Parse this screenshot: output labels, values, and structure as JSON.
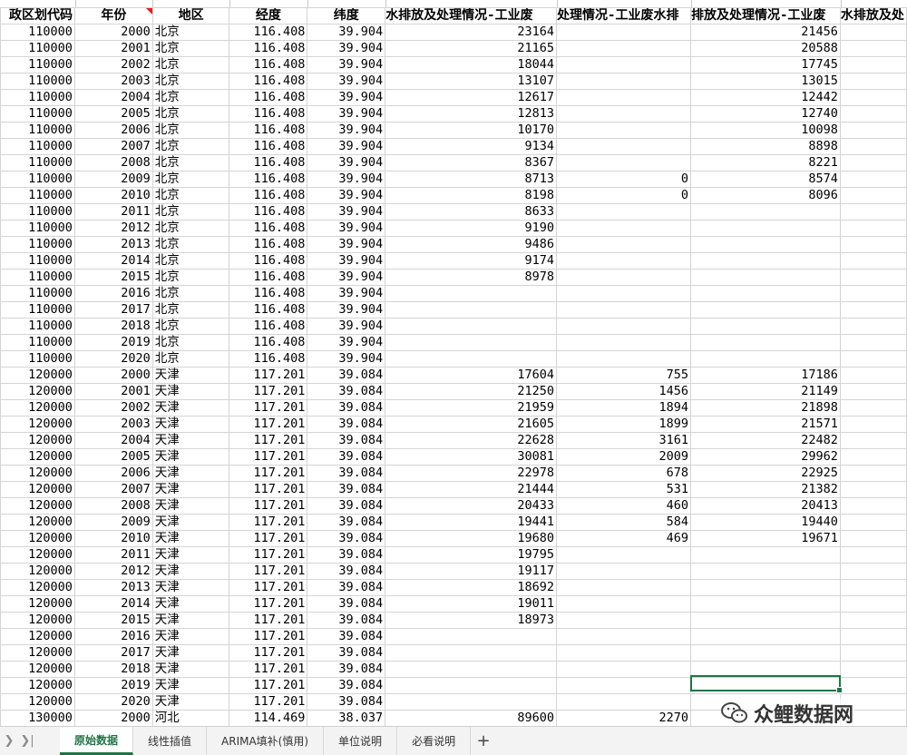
{
  "headers": [
    "政区划代码",
    "年份",
    "地区",
    "经度",
    "纬度",
    "水排放及处理情况-工业废",
    "处理情况-工业废水排",
    "排放及处理情况-工业废",
    "水排放及处"
  ],
  "rows": [
    [
      "110000",
      "2000",
      "北京",
      "116.408",
      "39.904",
      "23164",
      "",
      "21456"
    ],
    [
      "110000",
      "2001",
      "北京",
      "116.408",
      "39.904",
      "21165",
      "",
      "20588"
    ],
    [
      "110000",
      "2002",
      "北京",
      "116.408",
      "39.904",
      "18044",
      "",
      "17745"
    ],
    [
      "110000",
      "2003",
      "北京",
      "116.408",
      "39.904",
      "13107",
      "",
      "13015"
    ],
    [
      "110000",
      "2004",
      "北京",
      "116.408",
      "39.904",
      "12617",
      "",
      "12442"
    ],
    [
      "110000",
      "2005",
      "北京",
      "116.408",
      "39.904",
      "12813",
      "",
      "12740"
    ],
    [
      "110000",
      "2006",
      "北京",
      "116.408",
      "39.904",
      "10170",
      "",
      "10098"
    ],
    [
      "110000",
      "2007",
      "北京",
      "116.408",
      "39.904",
      "9134",
      "",
      "8898"
    ],
    [
      "110000",
      "2008",
      "北京",
      "116.408",
      "39.904",
      "8367",
      "",
      "8221"
    ],
    [
      "110000",
      "2009",
      "北京",
      "116.408",
      "39.904",
      "8713",
      "0",
      "8574"
    ],
    [
      "110000",
      "2010",
      "北京",
      "116.408",
      "39.904",
      "8198",
      "0",
      "8096"
    ],
    [
      "110000",
      "2011",
      "北京",
      "116.408",
      "39.904",
      "8633",
      "",
      ""
    ],
    [
      "110000",
      "2012",
      "北京",
      "116.408",
      "39.904",
      "9190",
      "",
      ""
    ],
    [
      "110000",
      "2013",
      "北京",
      "116.408",
      "39.904",
      "9486",
      "",
      ""
    ],
    [
      "110000",
      "2014",
      "北京",
      "116.408",
      "39.904",
      "9174",
      "",
      ""
    ],
    [
      "110000",
      "2015",
      "北京",
      "116.408",
      "39.904",
      "8978",
      "",
      ""
    ],
    [
      "110000",
      "2016",
      "北京",
      "116.408",
      "39.904",
      "",
      "",
      ""
    ],
    [
      "110000",
      "2017",
      "北京",
      "116.408",
      "39.904",
      "",
      "",
      ""
    ],
    [
      "110000",
      "2018",
      "北京",
      "116.408",
      "39.904",
      "",
      "",
      ""
    ],
    [
      "110000",
      "2019",
      "北京",
      "116.408",
      "39.904",
      "",
      "",
      ""
    ],
    [
      "110000",
      "2020",
      "北京",
      "116.408",
      "39.904",
      "",
      "",
      ""
    ],
    [
      "120000",
      "2000",
      "天津",
      "117.201",
      "39.084",
      "17604",
      "755",
      "17186"
    ],
    [
      "120000",
      "2001",
      "天津",
      "117.201",
      "39.084",
      "21250",
      "1456",
      "21149"
    ],
    [
      "120000",
      "2002",
      "天津",
      "117.201",
      "39.084",
      "21959",
      "1894",
      "21898"
    ],
    [
      "120000",
      "2003",
      "天津",
      "117.201",
      "39.084",
      "21605",
      "1899",
      "21571"
    ],
    [
      "120000",
      "2004",
      "天津",
      "117.201",
      "39.084",
      "22628",
      "3161",
      "22482"
    ],
    [
      "120000",
      "2005",
      "天津",
      "117.201",
      "39.084",
      "30081",
      "2009",
      "29962"
    ],
    [
      "120000",
      "2006",
      "天津",
      "117.201",
      "39.084",
      "22978",
      "678",
      "22925"
    ],
    [
      "120000",
      "2007",
      "天津",
      "117.201",
      "39.084",
      "21444",
      "531",
      "21382"
    ],
    [
      "120000",
      "2008",
      "天津",
      "117.201",
      "39.084",
      "20433",
      "460",
      "20413"
    ],
    [
      "120000",
      "2009",
      "天津",
      "117.201",
      "39.084",
      "19441",
      "584",
      "19440"
    ],
    [
      "120000",
      "2010",
      "天津",
      "117.201",
      "39.084",
      "19680",
      "469",
      "19671"
    ],
    [
      "120000",
      "2011",
      "天津",
      "117.201",
      "39.084",
      "19795",
      "",
      ""
    ],
    [
      "120000",
      "2012",
      "天津",
      "117.201",
      "39.084",
      "19117",
      "",
      ""
    ],
    [
      "120000",
      "2013",
      "天津",
      "117.201",
      "39.084",
      "18692",
      "",
      ""
    ],
    [
      "120000",
      "2014",
      "天津",
      "117.201",
      "39.084",
      "19011",
      "",
      ""
    ],
    [
      "120000",
      "2015",
      "天津",
      "117.201",
      "39.084",
      "18973",
      "",
      ""
    ],
    [
      "120000",
      "2016",
      "天津",
      "117.201",
      "39.084",
      "",
      "",
      ""
    ],
    [
      "120000",
      "2017",
      "天津",
      "117.201",
      "39.084",
      "",
      "",
      ""
    ],
    [
      "120000",
      "2018",
      "天津",
      "117.201",
      "39.084",
      "",
      "",
      ""
    ],
    [
      "120000",
      "2019",
      "天津",
      "117.201",
      "39.084",
      "",
      "",
      ""
    ],
    [
      "120000",
      "2020",
      "天津",
      "117.201",
      "39.084",
      "",
      "",
      ""
    ],
    [
      "130000",
      "2000",
      "河北",
      "114.469",
      "38.037",
      "89600",
      "2270",
      ""
    ]
  ],
  "tabs": [
    "原始数据",
    "线性插值",
    "ARIMA填补(慎用)",
    "单位说明",
    "必看说明"
  ],
  "active_tab": "原始数据",
  "watermark": "众鲤数据网",
  "colors": {
    "accent": "#217346",
    "comment_marker": "#e02020"
  }
}
